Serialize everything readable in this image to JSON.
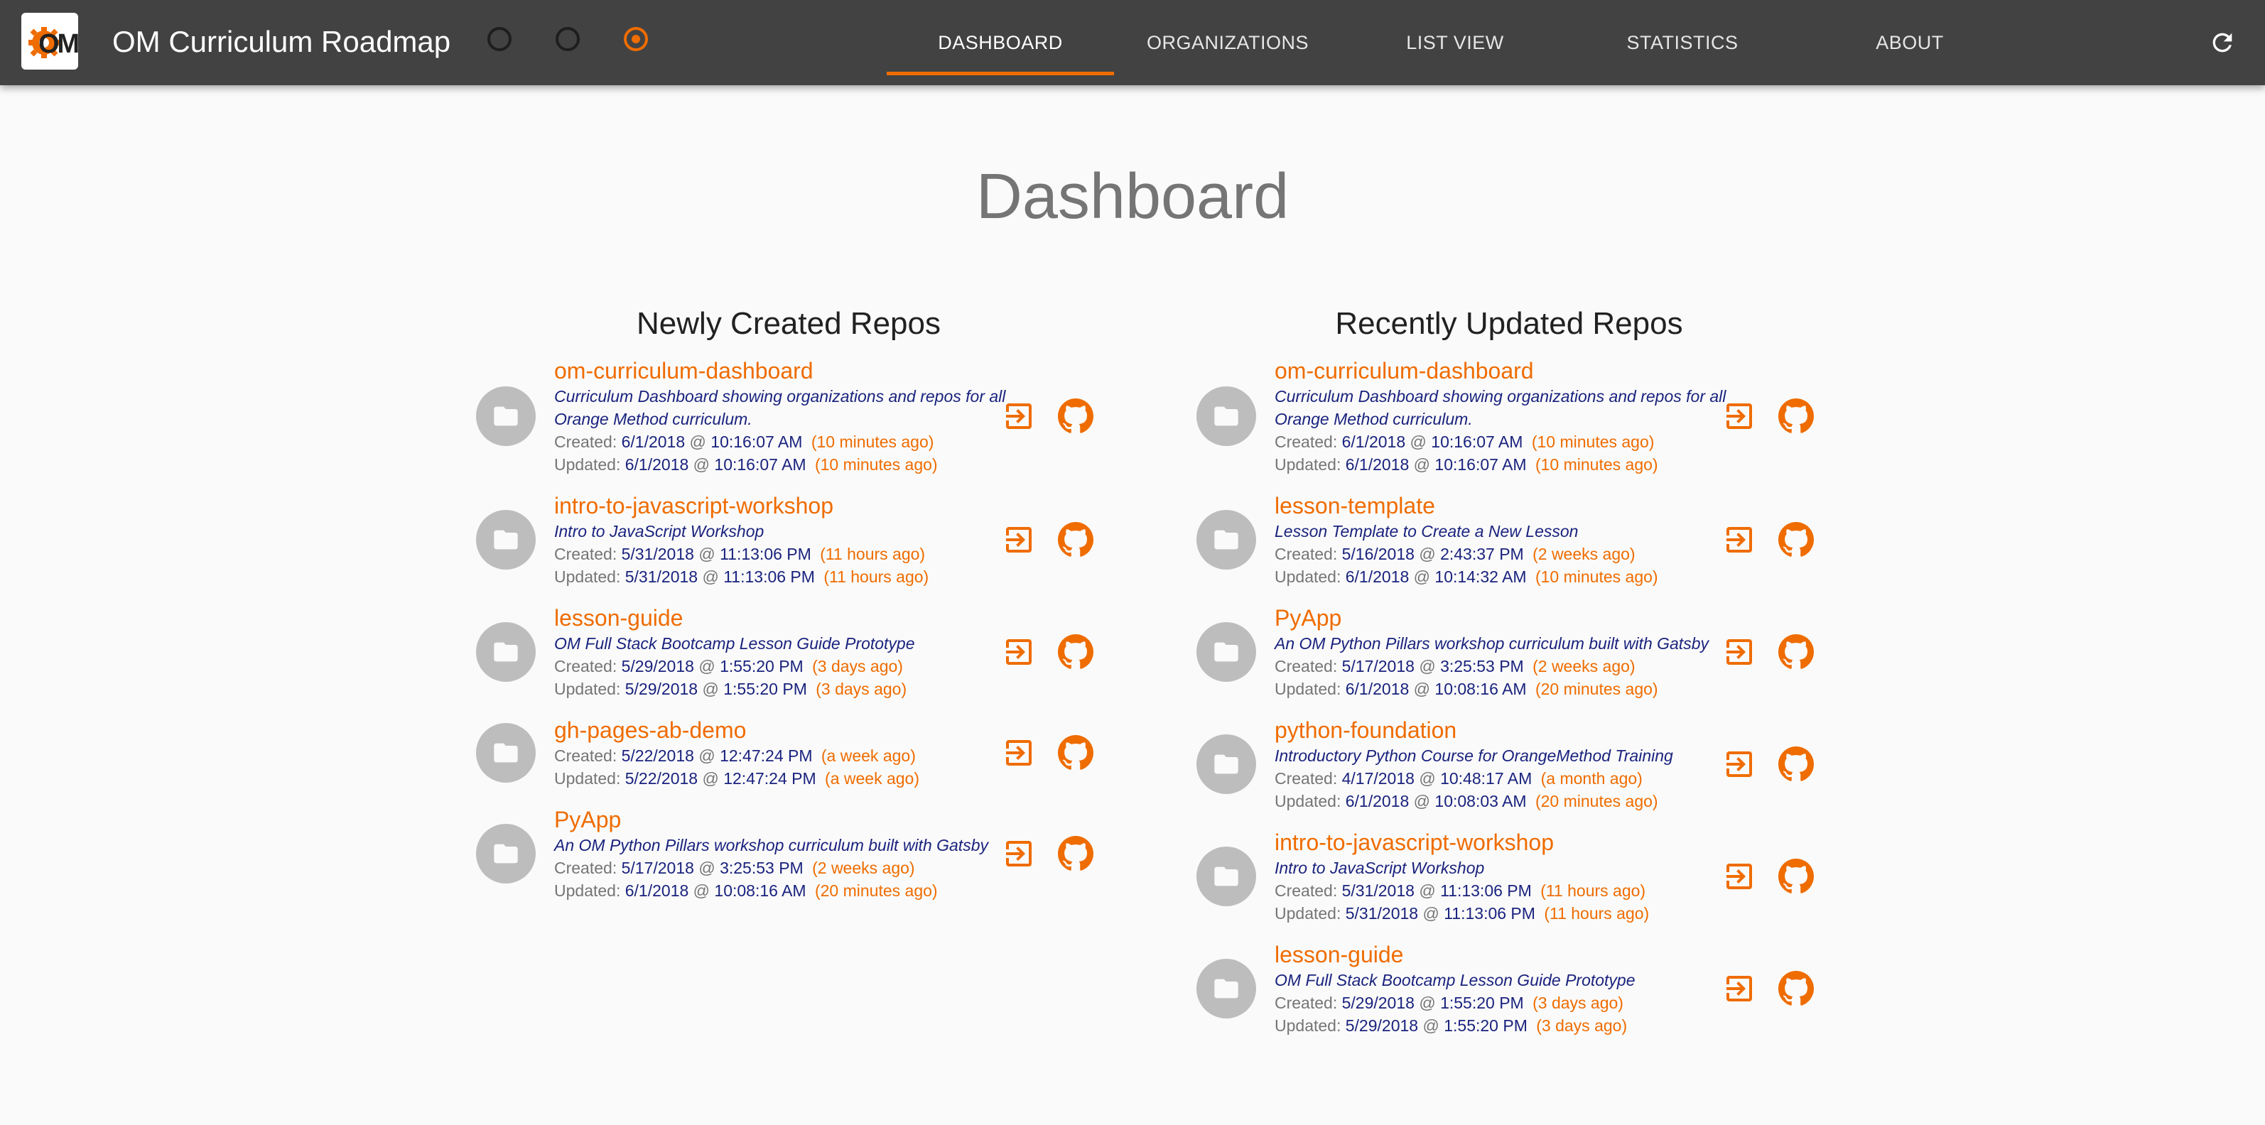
{
  "app": {
    "title": "OM Curriculum Roadmap",
    "logo_text": "OM",
    "accent": "#ef6c00",
    "bar_color": "#424242"
  },
  "theme_options": [
    {
      "color": "#1e1e1e",
      "selected": false
    },
    {
      "color": "#1e1e1e",
      "selected": false
    },
    {
      "color": "#ef6c00",
      "selected": true
    }
  ],
  "nav": {
    "tabs": [
      {
        "label": "DASHBOARD",
        "active": true
      },
      {
        "label": "ORGANIZATIONS",
        "active": false
      },
      {
        "label": "LIST VIEW",
        "active": false
      },
      {
        "label": "STATISTICS",
        "active": false
      },
      {
        "label": "ABOUT",
        "active": false
      }
    ],
    "refresh_icon": "refresh-icon"
  },
  "page": {
    "title": "Dashboard"
  },
  "labels": {
    "created": "Created:",
    "updated": "Updated:",
    "at": "@"
  },
  "icons": {
    "repo": "folder-icon",
    "open": "open-in-app-icon",
    "github": "github-icon"
  },
  "newly_created": {
    "title": "Newly Created Repos",
    "repos": [
      {
        "name": "om-curriculum-dashboard",
        "description": "Curriculum Dashboard showing organizations and repos for all Orange Method curriculum.",
        "created": {
          "date": "6/1/2018",
          "time": "10:16:07 AM",
          "ago": "(10 minutes ago)"
        },
        "updated": {
          "date": "6/1/2018",
          "time": "10:16:07 AM",
          "ago": "(10 minutes ago)"
        }
      },
      {
        "name": "intro-to-javascript-workshop",
        "description": "Intro to JavaScript Workshop",
        "created": {
          "date": "5/31/2018",
          "time": "11:13:06 PM",
          "ago": "(11 hours ago)"
        },
        "updated": {
          "date": "5/31/2018",
          "time": "11:13:06 PM",
          "ago": "(11 hours ago)"
        }
      },
      {
        "name": "lesson-guide",
        "description": "OM Full Stack Bootcamp Lesson Guide Prototype",
        "created": {
          "date": "5/29/2018",
          "time": "1:55:20 PM",
          "ago": "(3 days ago)"
        },
        "updated": {
          "date": "5/29/2018",
          "time": "1:55:20 PM",
          "ago": "(3 days ago)"
        }
      },
      {
        "name": "gh-pages-ab-demo",
        "description": "",
        "created": {
          "date": "5/22/2018",
          "time": "12:47:24 PM",
          "ago": "(a week ago)"
        },
        "updated": {
          "date": "5/22/2018",
          "time": "12:47:24 PM",
          "ago": "(a week ago)"
        }
      },
      {
        "name": "PyApp",
        "description": "An OM Python Pillars workshop curriculum built with Gatsby",
        "created": {
          "date": "5/17/2018",
          "time": "3:25:53 PM",
          "ago": "(2 weeks ago)"
        },
        "updated": {
          "date": "6/1/2018",
          "time": "10:08:16 AM",
          "ago": "(20 minutes ago)"
        }
      }
    ]
  },
  "recently_updated": {
    "title": "Recently Updated Repos",
    "repos": [
      {
        "name": "om-curriculum-dashboard",
        "description": "Curriculum Dashboard showing organizations and repos for all Orange Method curriculum.",
        "created": {
          "date": "6/1/2018",
          "time": "10:16:07 AM",
          "ago": "(10 minutes ago)"
        },
        "updated": {
          "date": "6/1/2018",
          "time": "10:16:07 AM",
          "ago": "(10 minutes ago)"
        }
      },
      {
        "name": "lesson-template",
        "description": "Lesson Template to Create a New Lesson",
        "created": {
          "date": "5/16/2018",
          "time": "2:43:37 PM",
          "ago": "(2 weeks ago)"
        },
        "updated": {
          "date": "6/1/2018",
          "time": "10:14:32 AM",
          "ago": "(10 minutes ago)"
        }
      },
      {
        "name": "PyApp",
        "description": "An OM Python Pillars workshop curriculum built with Gatsby",
        "created": {
          "date": "5/17/2018",
          "time": "3:25:53 PM",
          "ago": "(2 weeks ago)"
        },
        "updated": {
          "date": "6/1/2018",
          "time": "10:08:16 AM",
          "ago": "(20 minutes ago)"
        }
      },
      {
        "name": "python-foundation",
        "description": "Introductory Python Course for OrangeMethod Training",
        "created": {
          "date": "4/17/2018",
          "time": "10:48:17 AM",
          "ago": "(a month ago)"
        },
        "updated": {
          "date": "6/1/2018",
          "time": "10:08:03 AM",
          "ago": "(20 minutes ago)"
        }
      },
      {
        "name": "intro-to-javascript-workshop",
        "description": "Intro to JavaScript Workshop",
        "created": {
          "date": "5/31/2018",
          "time": "11:13:06 PM",
          "ago": "(11 hours ago)"
        },
        "updated": {
          "date": "5/31/2018",
          "time": "11:13:06 PM",
          "ago": "(11 hours ago)"
        }
      },
      {
        "name": "lesson-guide",
        "description": "OM Full Stack Bootcamp Lesson Guide Prototype",
        "created": {
          "date": "5/29/2018",
          "time": "1:55:20 PM",
          "ago": "(3 days ago)"
        },
        "updated": {
          "date": "5/29/2018",
          "time": "1:55:20 PM",
          "ago": "(3 days ago)"
        }
      }
    ]
  }
}
